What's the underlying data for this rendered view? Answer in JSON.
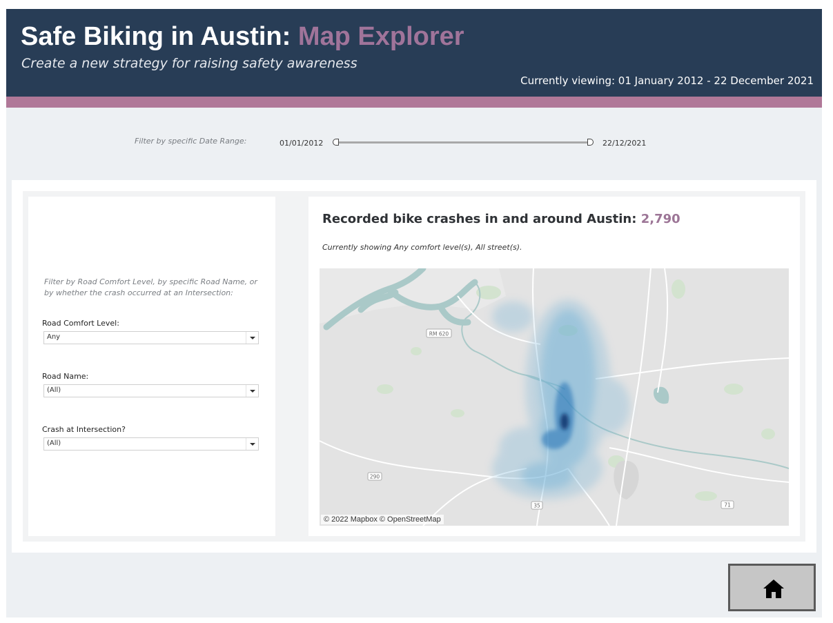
{
  "header": {
    "title_main": "Safe Biking in Austin: ",
    "title_accent": "Map Explorer",
    "subtitle": "Create a new strategy for raising safety awareness",
    "currently_viewing": "Currently viewing: 01 January 2012 - 22 December 2021"
  },
  "date_filter": {
    "label": "Filter by specific Date Range:",
    "start": "01/01/2012",
    "end": "22/12/2021",
    "start_fraction": 0.0,
    "end_fraction": 1.0
  },
  "filters": {
    "note": "Filter by Road Comfort Level, by specific Road Name, or by whether the crash occurred at an Intersection:",
    "road_comfort": {
      "label": "Road Comfort Level:",
      "value": "Any"
    },
    "road_name": {
      "label": "Road Name:",
      "value": "(All)"
    },
    "intersection": {
      "label": "Crash at Intersection?",
      "value": "(All)"
    }
  },
  "map": {
    "title": "Recorded bike crashes in and around Austin: ",
    "count": "2,790",
    "subtitle": "Currently showing Any comfort level(s), All street(s).",
    "attribution": "© 2022 Mapbox © OpenStreetMap",
    "road_labels": {
      "rm620": "RM 620",
      "r290": "290",
      "r71": "71",
      "r35": "35"
    }
  },
  "home_button": {
    "icon": "home-icon"
  },
  "colors": {
    "header_bg": "#283d56",
    "accent_purple": "#a0749a",
    "stripe": "#b07898",
    "dashboard_bg": "#edf0f3",
    "heat_light": "#9ecae1",
    "heat_dark": "#08306b"
  }
}
